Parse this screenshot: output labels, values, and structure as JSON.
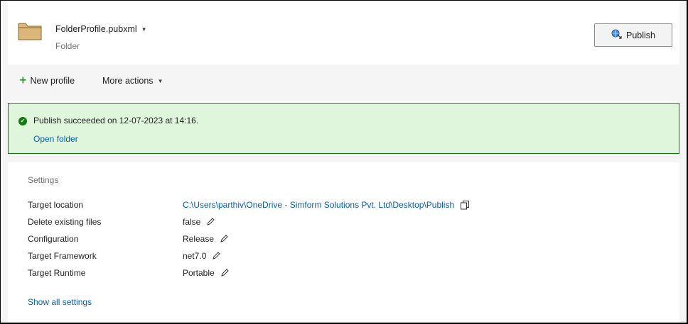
{
  "header": {
    "profile_name": "FolderProfile.pubxml",
    "profile_type": "Folder",
    "publish_label": "Publish"
  },
  "actions": {
    "new_profile": "New profile",
    "more_actions": "More actions"
  },
  "banner": {
    "message": "Publish succeeded on 12-07-2023 at 14:16.",
    "link": "Open folder"
  },
  "settings": {
    "title": "Settings",
    "rows": [
      {
        "label": "Target location",
        "value": "C:\\Users\\parthiv\\OneDrive - Simform Solutions Pvt. Ltd\\Desktop\\Publish"
      },
      {
        "label": "Delete existing files",
        "value": "false"
      },
      {
        "label": "Configuration",
        "value": "Release"
      },
      {
        "label": "Target Framework",
        "value": "net7.0"
      },
      {
        "label": "Target Runtime",
        "value": "Portable"
      }
    ],
    "show_all": "Show all settings"
  },
  "colors": {
    "accent_link": "#005fb8",
    "success_green": "#107c10",
    "success_bg": "#dff6dd",
    "folder_fill": "#dcb67a"
  },
  "icons": [
    "folder-icon",
    "globe-publish-icon",
    "plus-icon",
    "chevron-down-icon",
    "check-circle-icon",
    "copy-icon",
    "pencil-icon"
  ]
}
